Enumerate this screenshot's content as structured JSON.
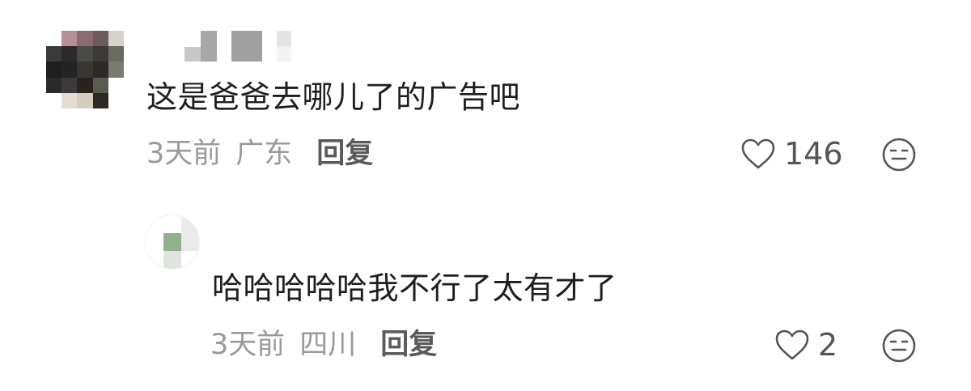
{
  "comments": [
    {
      "text": "这是爸爸去哪儿了的广告吧",
      "time": "3天前",
      "location": "广东",
      "reply_label": "回复",
      "like_count": "146",
      "like_icon": "heart-outline",
      "dislike_icon": "neutral-face"
    },
    {
      "text": "哈哈哈哈哈我不行了太有才了",
      "time": "3天前",
      "location": "四川",
      "reply_label": "回复",
      "like_count": "2",
      "like_icon": "heart-outline",
      "dislike_icon": "neutral-face"
    }
  ],
  "colors": {
    "text_primary": "#1e1e1e",
    "text_secondary": "#9a9a9a",
    "reply": "#5a5a5a",
    "icon": "#555555"
  }
}
